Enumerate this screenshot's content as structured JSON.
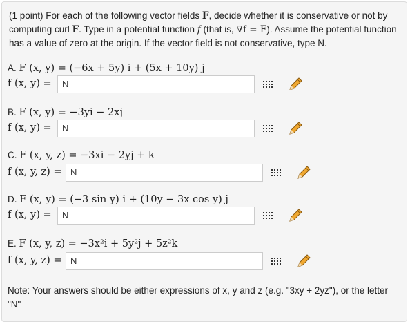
{
  "intro": {
    "part1": "(1 point) For each of the following vector fields ",
    "F1": "F",
    "part2": ", decide whether it is conservative or not by computing curl ",
    "F2": "F",
    "part3": ". Type in a potential function ",
    "f1": "f",
    "part4": " (that is, ",
    "nabla": "∇f = F",
    "part5": "). Assume the potential function has a value of zero at the origin. If the vector field is not conservative, type N."
  },
  "questions": [
    {
      "letter": "A.",
      "field": "F (x, y) = (−6x + 5y) i + (5x + 10y) j",
      "f_label": "f (x, y) =",
      "answer": "N"
    },
    {
      "letter": "B.",
      "field": "F (x, y) = −3yi − 2xj",
      "f_label": "f (x, y) =",
      "answer": "N"
    },
    {
      "letter": "C.",
      "field": "F (x, y, z) = −3xi − 2yj + k",
      "f_label": "f (x, y, z) =",
      "answer": "N"
    },
    {
      "letter": "D.",
      "field": "F (x, y) = (−3 sin y) i + (10y − 3x cos y) j",
      "f_label": "f (x, y) =",
      "answer": "N"
    },
    {
      "letter": "E.",
      "field": "F (x, y, z) = −3x²i + 5y²j + 5z²k",
      "f_label": "f (x, y, z) =",
      "answer": "N"
    }
  ],
  "note": "Note: Your answers should be either expressions of x, y and z (e.g. \"3xy + 2yz\"), or the letter \"N\"",
  "icons": {
    "grid": "equation-editor-grid-icon",
    "pencil": "pencil-icon"
  },
  "colors": {
    "panel_bg": "#f5f5f5",
    "panel_border": "#dcdcdc",
    "pencil": "#f0a830"
  }
}
